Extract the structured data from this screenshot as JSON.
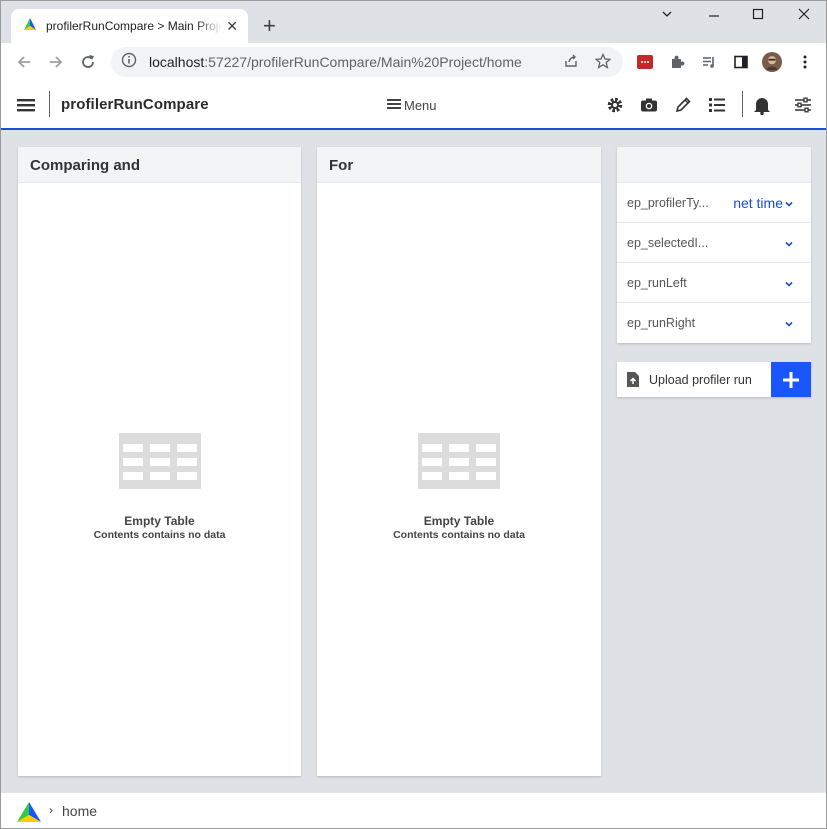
{
  "browser": {
    "tab_title": "profilerRunCompare > Main Project",
    "tab_close": "✕",
    "new_tab": "+",
    "url_host": "localhost",
    "url_rest": ":57227/profilerRunCompare/Main%20Project/home",
    "window_controls": {
      "minimize": "—",
      "restore": "☐",
      "close": "✕"
    }
  },
  "appbar": {
    "title": "profilerRunCompare",
    "menu_label": "Menu"
  },
  "panels": [
    {
      "title": "Comparing and",
      "empty_title": "Empty Table",
      "empty_sub": "Contents contains no data"
    },
    {
      "title": "For",
      "empty_title": "Empty Table",
      "empty_sub": "Contents contains no data"
    }
  ],
  "parameters": [
    {
      "name": "ep_profilerTy...",
      "value": "net time"
    },
    {
      "name": "ep_selectedI...",
      "value": ""
    },
    {
      "name": "ep_runLeft",
      "value": ""
    },
    {
      "name": "ep_runRight",
      "value": ""
    }
  ],
  "upload": {
    "label": "Upload profiler run"
  },
  "footer": {
    "breadcrumb": "home",
    "separator": "›"
  },
  "colors": {
    "accent": "#1a4fd0",
    "add_button": "#1a56ff",
    "background": "#dee1e6"
  }
}
